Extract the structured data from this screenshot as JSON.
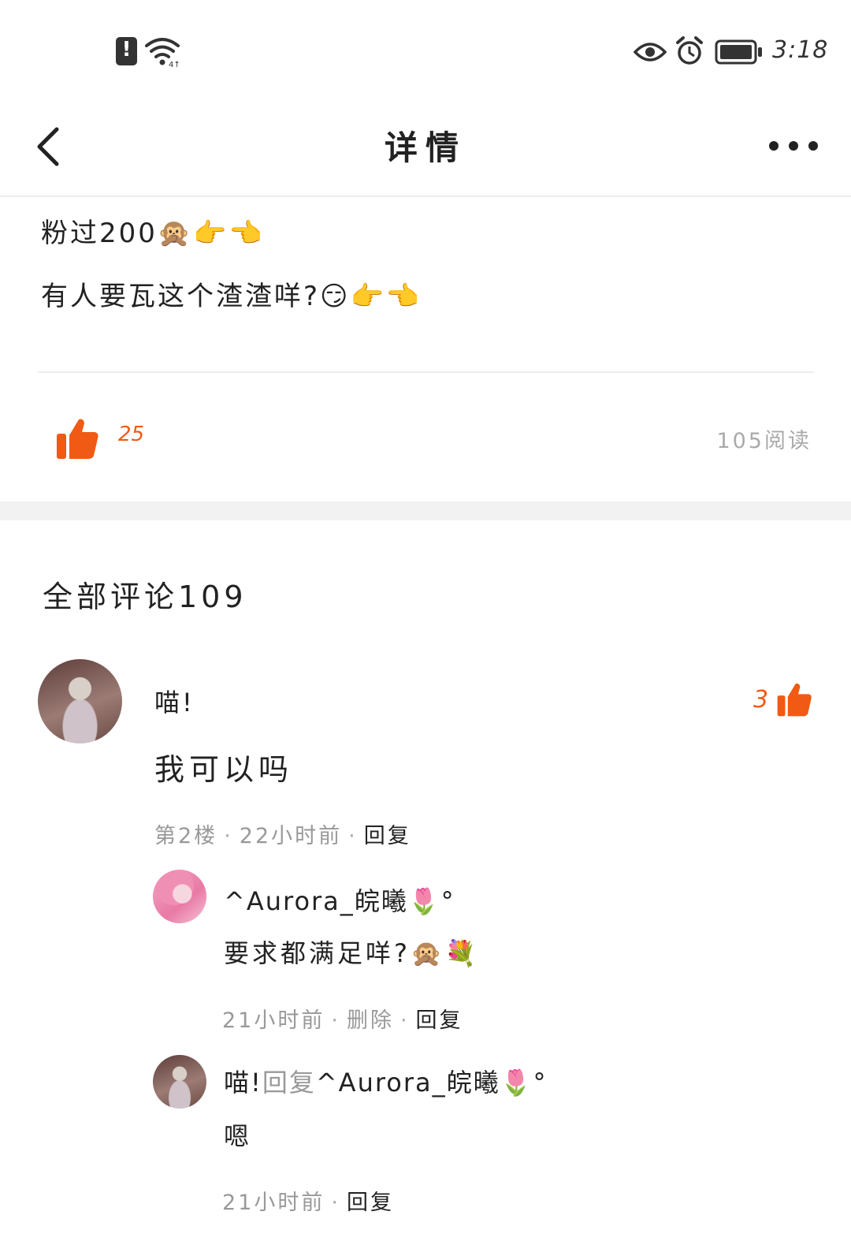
{
  "status_bar": {
    "time": "3:18",
    "icons": [
      "warning-icon",
      "wifi-icon",
      "eye-icon",
      "alarm-icon",
      "battery-icon"
    ]
  },
  "header": {
    "title": "详情",
    "back_icon": "chevron-left-icon",
    "more_icon": "more-dots-icon"
  },
  "post": {
    "line1": "粉过200🙊👉👈",
    "line2": "有人要瓦这个渣渣咩?😏👉👈",
    "likes": "25",
    "reads": "105阅读"
  },
  "comments": {
    "title": "全部评论109",
    "items": [
      {
        "user": "喵!",
        "likes": "3",
        "text": "我可以吗",
        "floor": "第2楼",
        "time": "22小时前",
        "reply_action": "回复",
        "replies": [
          {
            "user": "^Aurora_皖曦🌷°",
            "text": "要求都满足咩?🙊💐",
            "time": "21小时前",
            "delete_action": "删除",
            "reply_action": "回复"
          },
          {
            "user": "喵!",
            "reply_word": "回复",
            "reply_to": "^Aurora_皖曦🌷°",
            "text": "嗯",
            "time": "21小时前",
            "reply_action": "回复"
          }
        ]
      }
    ]
  },
  "colors": {
    "accent": "#f05a14",
    "muted": "#999999",
    "divider": "#eeeeee"
  }
}
